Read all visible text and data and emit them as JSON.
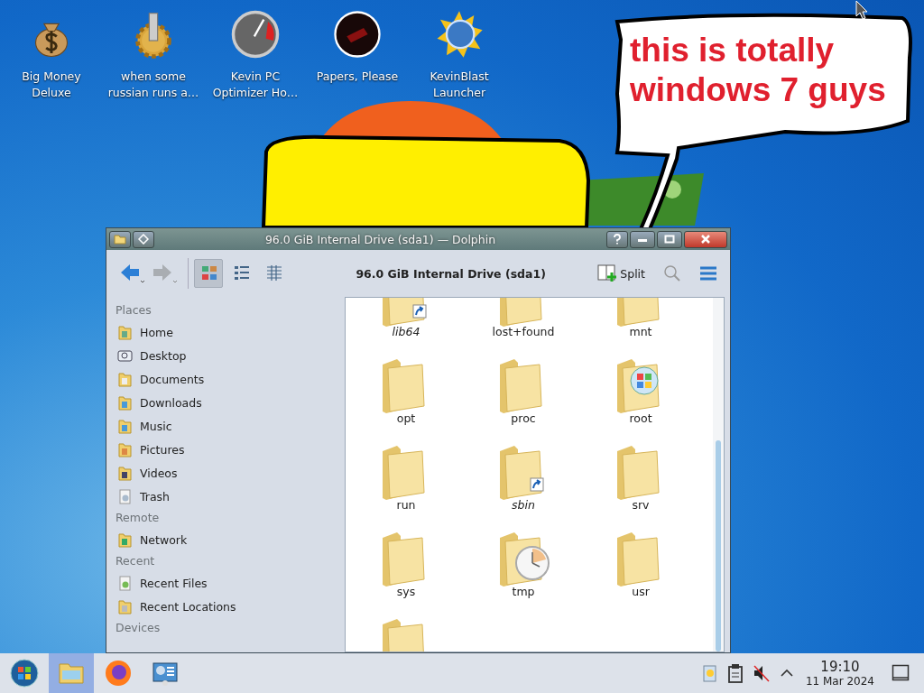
{
  "desktop_icons": [
    {
      "kind": "moneybag",
      "lines": [
        "Big Money",
        "Deluxe"
      ]
    },
    {
      "kind": "gear",
      "lines": [
        "when some",
        "russian runs a…"
      ]
    },
    {
      "kind": "gauge",
      "lines": [
        "Kevin PC",
        "Optimizer Ho…"
      ]
    },
    {
      "kind": "disc",
      "lines": [
        "Papers, Please"
      ]
    },
    {
      "kind": "globe",
      "lines": [
        "KevinBlast",
        "Launcher"
      ]
    }
  ],
  "speech_bubble": {
    "text": "this is totally windows 7 guys"
  },
  "window": {
    "title": "96.0 GiB Internal Drive (sda1) — Dolphin",
    "toolbar": {
      "back": {
        "disabled": false
      },
      "forward": {
        "disabled": true
      },
      "view_modes": [
        {
          "kind": "icons",
          "selected": true
        },
        {
          "kind": "compact",
          "selected": false
        },
        {
          "kind": "details",
          "selected": false
        }
      ],
      "location": "96.0 GiB Internal Drive (sda1)",
      "split": "Split"
    },
    "sidebar": [
      {
        "heading": "Places",
        "items": [
          {
            "kind": "home",
            "label": "Home"
          },
          {
            "kind": "desktop",
            "label": "Desktop"
          },
          {
            "kind": "documents",
            "label": "Documents"
          },
          {
            "kind": "downloads",
            "label": "Downloads"
          },
          {
            "kind": "music",
            "label": "Music"
          },
          {
            "kind": "pictures",
            "label": "Pictures"
          },
          {
            "kind": "videos",
            "label": "Videos"
          },
          {
            "kind": "trash",
            "label": "Trash"
          }
        ]
      },
      {
        "heading": "Remote",
        "items": [
          {
            "kind": "network",
            "label": "Network"
          }
        ]
      },
      {
        "heading": "Recent",
        "items": [
          {
            "kind": "recent-files",
            "label": "Recent Files"
          },
          {
            "kind": "recent-locations",
            "label": "Recent Locations"
          }
        ]
      },
      {
        "heading": "Devices"
      }
    ],
    "files": [
      {
        "name": "lib64",
        "kind": "link"
      },
      {
        "name": "lost+found",
        "kind": "plain"
      },
      {
        "name": "mnt",
        "kind": "plain"
      },
      {
        "name": "opt",
        "kind": "plain"
      },
      {
        "name": "proc",
        "kind": "plain"
      },
      {
        "name": "root",
        "kind": "windows"
      },
      {
        "name": "run",
        "kind": "plain"
      },
      {
        "name": "sbin",
        "kind": "link"
      },
      {
        "name": "srv",
        "kind": "plain"
      },
      {
        "name": "sys",
        "kind": "plain"
      },
      {
        "name": "tmp",
        "kind": "clock"
      },
      {
        "name": "usr",
        "kind": "plain"
      },
      {
        "kind": "plain"
      }
    ]
  },
  "taskbar": {
    "launchers": [
      {
        "kind": "start",
        "selected": false
      },
      {
        "kind": "files",
        "selected": true
      },
      {
        "kind": "firefox",
        "selected": false
      },
      {
        "kind": "settings",
        "selected": false
      }
    ],
    "tray": {
      "volume_muted": true
    },
    "time": "19:10",
    "date": "11 Mar 2024"
  }
}
